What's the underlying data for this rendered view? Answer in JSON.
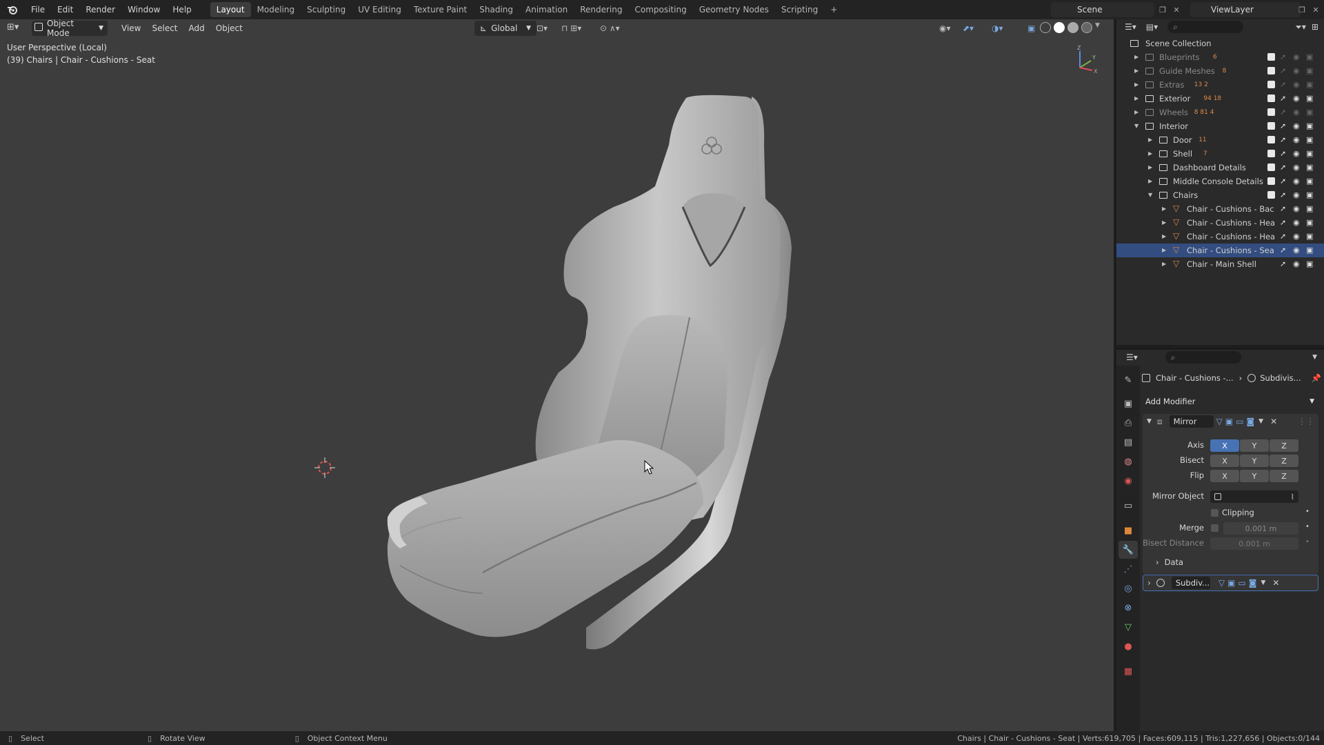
{
  "topbar": {
    "menu": [
      "File",
      "Edit",
      "Render",
      "Window",
      "Help"
    ],
    "workspaces": [
      "Layout",
      "Modeling",
      "Sculpting",
      "UV Editing",
      "Texture Paint",
      "Shading",
      "Animation",
      "Rendering",
      "Compositing",
      "Geometry Nodes",
      "Scripting"
    ],
    "active_workspace": "Layout",
    "add_tab": "+",
    "scene": "Scene",
    "view_layer": "ViewLayer"
  },
  "viewport": {
    "mode": "Object Mode",
    "menus": [
      "View",
      "Select",
      "Add",
      "Object"
    ],
    "transform_orientation": "Global",
    "perspective_label": "User Perspective (Local)",
    "selection_label": "(39) Chairs | Chair - Cushions - Seat",
    "background": "#3d3d3d",
    "gizmo_axes": [
      "Z",
      "Y",
      "X"
    ]
  },
  "outliner": {
    "root": "Scene Collection",
    "rows": [
      {
        "label": "Blueprints",
        "depth": 1,
        "dim": true,
        "counts": "6"
      },
      {
        "label": "Guide Meshes",
        "depth": 1,
        "dim": true,
        "counts": "8"
      },
      {
        "label": "Extras",
        "depth": 1,
        "dim": true,
        "counts": "13 2"
      },
      {
        "label": "Exterior",
        "depth": 1,
        "dim": false,
        "counts": "94 18"
      },
      {
        "label": "Wheels",
        "depth": 1,
        "dim": true,
        "counts": "8 81 4"
      },
      {
        "label": "Interior",
        "depth": 1,
        "dim": false,
        "expanded": true
      },
      {
        "label": "Door",
        "depth": 2,
        "dim": false,
        "counts": "11"
      },
      {
        "label": "Shell",
        "depth": 2,
        "dim": false,
        "counts": "7"
      },
      {
        "label": "Dashboard Details",
        "depth": 2,
        "dim": false
      },
      {
        "label": "Middle Console Details",
        "depth": 2,
        "dim": false
      },
      {
        "label": "Chairs",
        "depth": 2,
        "dim": false,
        "expanded": true
      },
      {
        "label": "Chair - Cushions - Bac",
        "depth": 3,
        "mesh": true
      },
      {
        "label": "Chair - Cushions - Hea",
        "depth": 3,
        "mesh": true
      },
      {
        "label": "Chair - Cushions - Hea",
        "depth": 3,
        "mesh": true
      },
      {
        "label": "Chair - Cushions - Sea",
        "depth": 3,
        "mesh": true,
        "active": true
      },
      {
        "label": "Chair - Main Shell",
        "depth": 3,
        "mesh": true
      }
    ]
  },
  "properties": {
    "breadcrumb_object": "Chair - Cushions -...",
    "breadcrumb_modifier": "Subdivis...",
    "add_modifier": "Add Modifier",
    "mirror": {
      "name": "Mirror",
      "axis_label": "Axis",
      "bisect_label": "Bisect",
      "flip_label": "Flip",
      "axes": [
        "X",
        "Y",
        "Z"
      ],
      "axis_on": [
        true,
        false,
        false
      ],
      "mirror_object_label": "Mirror Object",
      "clipping_label": "Clipping",
      "merge_label": "Merge",
      "merge_value": "0.001 m",
      "bisect_distance_label": "Bisect Distance",
      "bisect_distance_value": "0.001 m",
      "data_label": "Data"
    },
    "subdiv": {
      "name": "Subdiv..."
    }
  },
  "statusbar": {
    "select": "Select",
    "rotate": "Rotate View",
    "context": "Object Context Menu",
    "stats": "Chairs | Chair - Cushions - Seat | Verts:619,705 | Faces:609,115 | Tris:1,227,656 | Objects:0/144"
  }
}
